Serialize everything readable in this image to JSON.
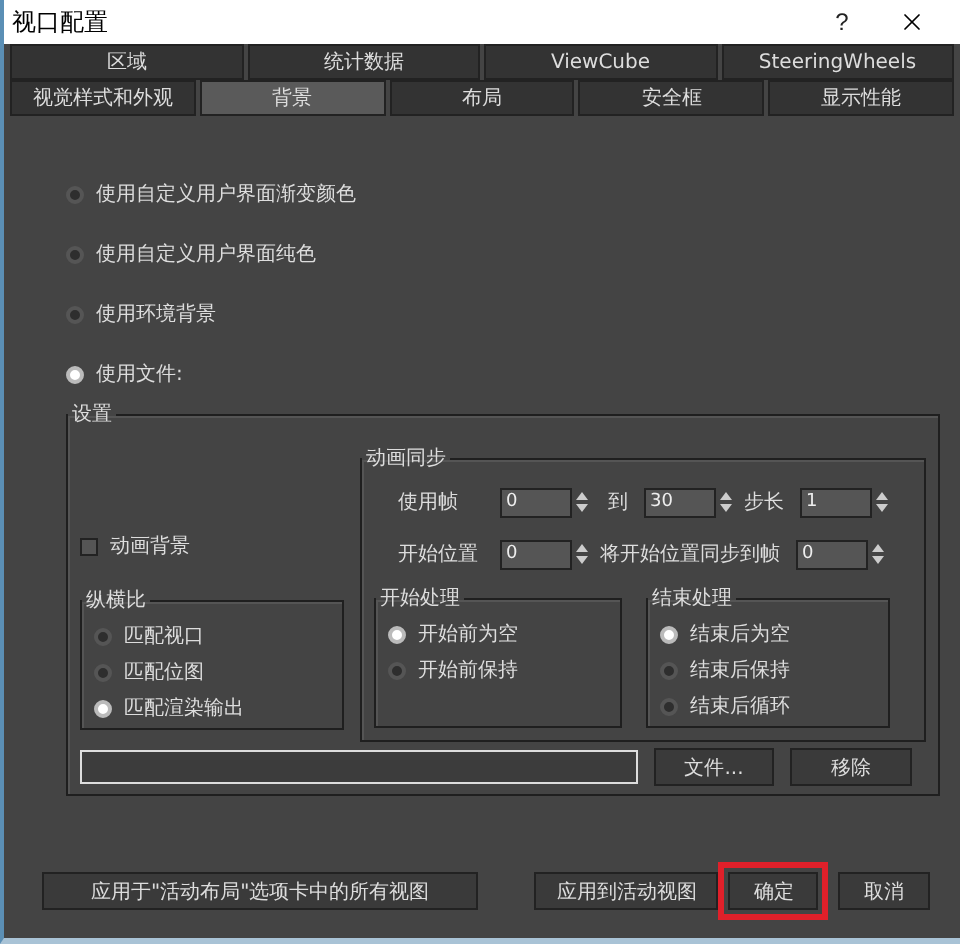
{
  "window": {
    "title": "视口配置",
    "help": "?"
  },
  "tab_rows": [
    [
      {
        "label": "区域",
        "selected": false
      },
      {
        "label": "统计数据",
        "selected": false
      },
      {
        "label": "ViewCube",
        "selected": false
      },
      {
        "label": "SteeringWheels",
        "selected": false
      }
    ],
    [
      {
        "label": "视觉样式和外观",
        "selected": false
      },
      {
        "label": "背景",
        "selected": true
      },
      {
        "label": "布局",
        "selected": false
      },
      {
        "label": "安全框",
        "selected": false
      },
      {
        "label": "显示性能",
        "selected": false
      }
    ]
  ],
  "background_source": [
    {
      "label": "使用自定义用户界面渐变颜色",
      "selected": false
    },
    {
      "label": "使用自定义用户界面纯色",
      "selected": false
    },
    {
      "label": "使用环境背景",
      "selected": false
    },
    {
      "label": "使用文件:",
      "selected": true
    }
  ],
  "settings": {
    "title": "设置",
    "animate_background": {
      "label": "动画背景",
      "checked": false
    },
    "aspect_ratio": {
      "title": "纵横比",
      "options": [
        {
          "label": "匹配视口",
          "selected": false
        },
        {
          "label": "匹配位图",
          "selected": false
        },
        {
          "label": "匹配渲染输出",
          "selected": true
        }
      ]
    },
    "animation_sync": {
      "title": "动画同步",
      "use_frames": {
        "label": "使用帧",
        "from": "0",
        "to_label": "到",
        "to": "30",
        "step_label": "步长",
        "step": "1"
      },
      "start_at": {
        "label": "开始位置",
        "value": "0",
        "sync_label": "将开始位置同步到帧",
        "sync_value": "0"
      },
      "start_processing": {
        "title": "开始处理",
        "options": [
          {
            "label": "开始前为空",
            "selected": true
          },
          {
            "label": "开始前保持",
            "selected": false
          }
        ]
      },
      "end_processing": {
        "title": "结束处理",
        "options": [
          {
            "label": "结束后为空",
            "selected": true
          },
          {
            "label": "结束后保持",
            "selected": false
          },
          {
            "label": "结束后循环",
            "selected": false
          }
        ]
      }
    },
    "file_button": "文件...",
    "remove_button": "移除"
  },
  "footer": [
    {
      "label": "应用于\"活动布局\"选项卡中的所有视图",
      "highlighted": false
    },
    {
      "label": "应用到活动视图",
      "highlighted": false
    },
    {
      "label": "确定",
      "highlighted": true
    },
    {
      "label": "取消",
      "highlighted": false
    }
  ]
}
